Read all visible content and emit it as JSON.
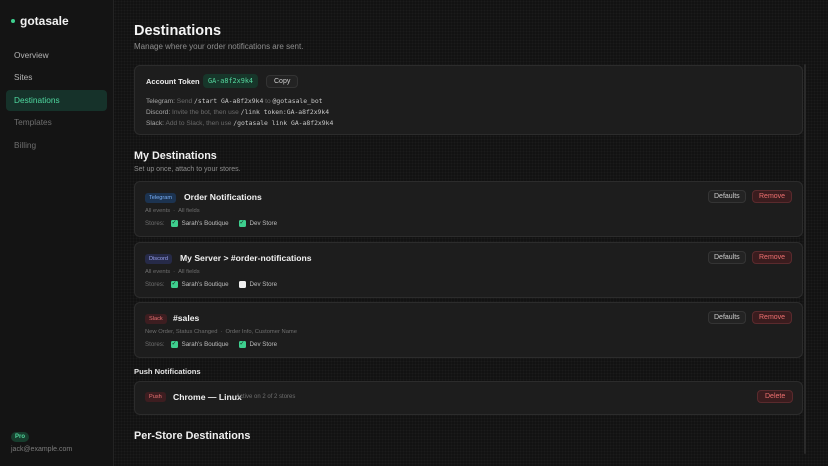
{
  "sidebar": {
    "brand": "gotasale",
    "items": [
      {
        "label": "Overview"
      },
      {
        "label": "Sites"
      },
      {
        "label": "Destinations"
      },
      {
        "label": "Templates"
      },
      {
        "label": "Billing"
      }
    ],
    "active_item": "Destinations",
    "plan": "Pro",
    "user_email": "jack@example.com"
  },
  "header": {
    "title": "Destinations",
    "subtitle": "Manage where your order notifications are sent."
  },
  "token": {
    "label": "Account Token",
    "value": "GA-a8f2x9k4",
    "copy_label": "Copy",
    "telegram": {
      "name": "Telegram:",
      "pre": "Send",
      "code": "/start GA-a8f2x9k4",
      "mid": "to",
      "target": "@gotasale_bot"
    },
    "discord": {
      "name": "Discord:",
      "pre": "Invite the bot, then use",
      "code": "/link token:GA-a8f2x9k4"
    },
    "slack": {
      "name": "Slack:",
      "pre": "Add to Slack, then use",
      "code": "/gotasale link GA-a8f2x9k4"
    }
  },
  "my_destinations": {
    "title": "My Destinations",
    "subtitle": "Set up once, attach to your stores.",
    "defaults_label": "Defaults",
    "remove_label": "Remove",
    "stores_label": "Stores:",
    "items": [
      {
        "platform": "Telegram",
        "name": "Order Notifications",
        "events": "All events",
        "fields": "All fields",
        "stores": [
          {
            "name": "Sarah's Boutique",
            "checked": true
          },
          {
            "name": "Dev Store",
            "checked": true
          }
        ]
      },
      {
        "platform": "Discord",
        "name": "My Server > #order-notifications",
        "events": "All events",
        "fields": "All fields",
        "stores": [
          {
            "name": "Sarah's Boutique",
            "checked": true
          },
          {
            "name": "Dev Store",
            "checked": false
          }
        ]
      },
      {
        "platform": "Slack",
        "name": "#sales",
        "events": "New Order, Status Changed",
        "fields": "Order Info, Customer Name",
        "stores": [
          {
            "name": "Sarah's Boutique",
            "checked": true
          },
          {
            "name": "Dev Store",
            "checked": true
          }
        ]
      }
    ]
  },
  "push": {
    "title": "Push Notifications",
    "badge": "Push",
    "name": "Chrome — Linux",
    "status": "Active on 2 of 2 stores",
    "delete_label": "Delete"
  },
  "per_store": {
    "title": "Per-Store Destinations"
  },
  "colors": {
    "accent": "#3ecf8e",
    "danger": "#ee7070",
    "background": "#121212"
  }
}
